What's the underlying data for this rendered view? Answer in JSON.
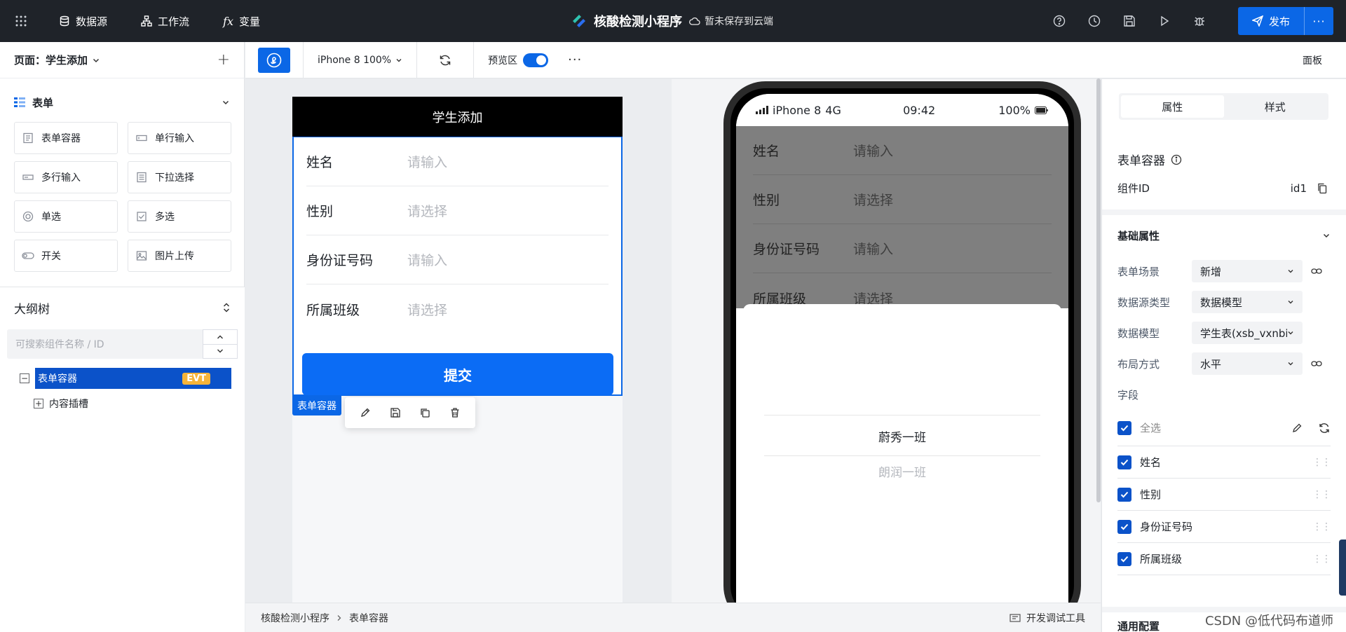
{
  "topbar": {
    "nav": [
      {
        "label": "数据源",
        "icon": "database-icon"
      },
      {
        "label": "工作流",
        "icon": "workflow-icon"
      },
      {
        "label": "变量",
        "icon": "function-icon"
      }
    ],
    "app_name": "核酸检测小程序",
    "save_status": "暂未保存到云端",
    "publish_label": "发布"
  },
  "left": {
    "page_label": "页面：学生添加",
    "group_title": "表单",
    "components": [
      {
        "label": "表单容器",
        "icon": "form-container-icon"
      },
      {
        "label": "单行输入",
        "icon": "single-input-icon"
      },
      {
        "label": "多行输入",
        "icon": "multi-input-icon"
      },
      {
        "label": "下拉选择",
        "icon": "dropdown-icon"
      },
      {
        "label": "单选",
        "icon": "radio-icon"
      },
      {
        "label": "多选",
        "icon": "checkbox-icon"
      },
      {
        "label": "开关",
        "icon": "switch-icon"
      },
      {
        "label": "图片上传",
        "icon": "image-upload-icon"
      }
    ],
    "outline_title": "大纲树",
    "search_placeholder": "可搜索组件名称 / ID",
    "tree": {
      "selected": "表单容器",
      "badge": "EVT",
      "child": "内容插槽"
    }
  },
  "toolbar": {
    "device": "iPhone 8 100%",
    "preview_label": "预览区",
    "panel_label": "面板"
  },
  "simulator": {
    "page_title": "学生添加",
    "fields": [
      {
        "label": "姓名",
        "placeholder": "请输入"
      },
      {
        "label": "性别",
        "placeholder": "请选择"
      },
      {
        "label": "身份证号码",
        "placeholder": "请输入"
      },
      {
        "label": "所属班级",
        "placeholder": "请选择"
      }
    ],
    "submit": "提交",
    "form_tag": "表单容器"
  },
  "phone": {
    "carrier": "iPhone 8",
    "network": "4G",
    "time": "09:42",
    "battery": "100%",
    "fields": [
      {
        "label": "姓名",
        "placeholder": "请输入"
      },
      {
        "label": "性别",
        "placeholder": "请选择"
      },
      {
        "label": "身份证号码",
        "placeholder": "请输入"
      },
      {
        "label": "所属班级",
        "placeholder": "请选择"
      }
    ],
    "picker_options": [
      "蔚秀一班",
      "朗润一班"
    ]
  },
  "bottom": {
    "crumbs": [
      "核酸检测小程序",
      "表单容器"
    ],
    "devtools": "开发调试工具"
  },
  "right": {
    "tabs": [
      "属性",
      "样式"
    ],
    "component_title": "表单容器",
    "id_label": "组件ID",
    "id_value": "id1",
    "section_basic": "基础属性",
    "props": [
      {
        "label": "表单场景",
        "value": "新增"
      },
      {
        "label": "数据源类型",
        "value": "数据模型"
      },
      {
        "label": "数据模型",
        "value": "学生表(xsb_vxnbi"
      },
      {
        "label": "布局方式",
        "value": "水平"
      }
    ],
    "fields_label": "字段",
    "select_all": "全选",
    "fields": [
      "姓名",
      "性别",
      "身份证号码",
      "所属班级"
    ],
    "section_common": "通用配置"
  },
  "watermark": "CSDN @低代码布道师",
  "colors": {
    "primary": "#0b67e6",
    "topbar": "#1f2329",
    "badge": "#f6b43a"
  }
}
